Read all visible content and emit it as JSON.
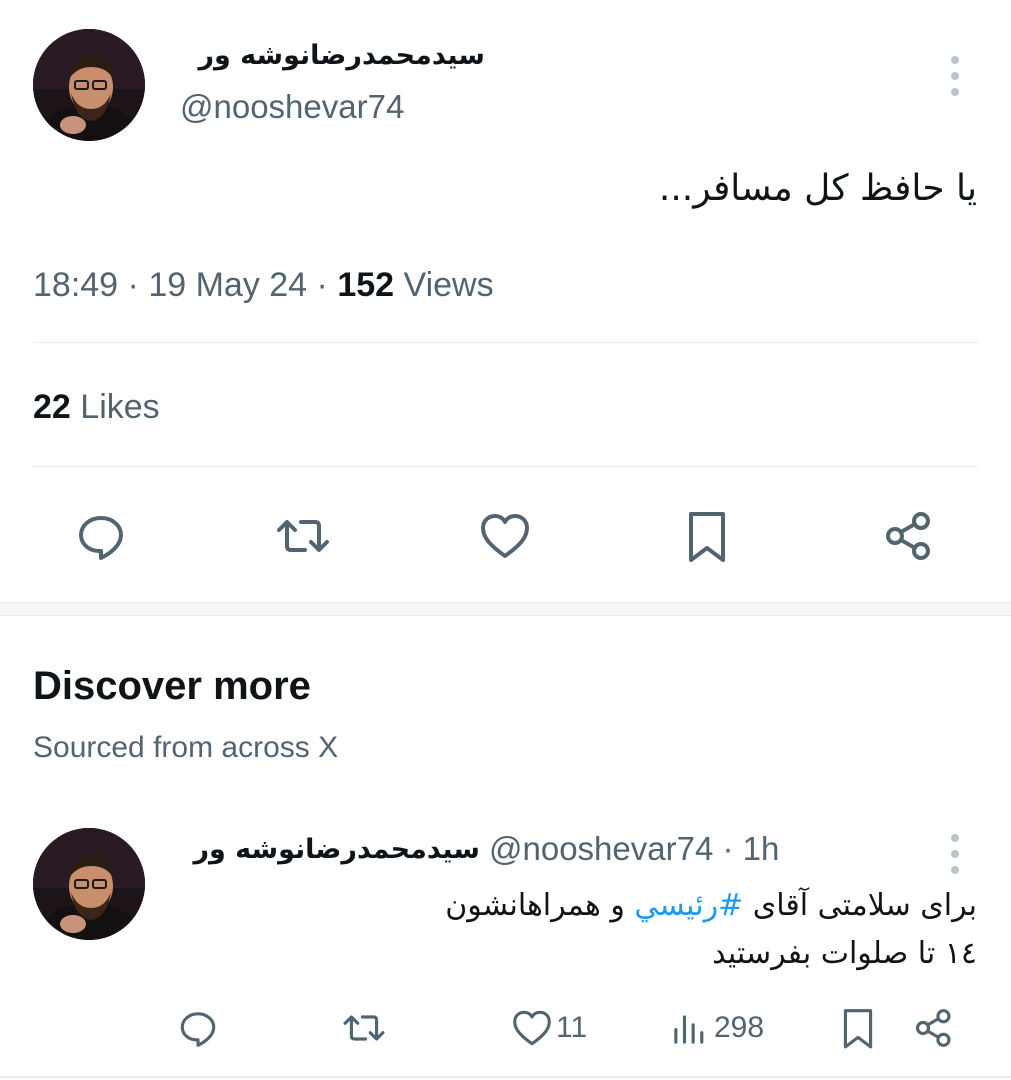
{
  "main_tweet": {
    "display_name": "سیدمحمدرضانوشه ور",
    "handle": "@nooshevar74",
    "text": "یا حافظ کل مسافر...",
    "time": "18:49",
    "date": "19 May 24",
    "views_count": "152",
    "views_label": "Views",
    "likes_count": "22",
    "likes_label": "Likes",
    "actions": [
      "reply-icon",
      "retweet-icon",
      "like-icon",
      "bookmark-icon",
      "share-icon"
    ]
  },
  "discover": {
    "title": "Discover more",
    "subtitle": "Sourced from across X"
  },
  "sub_tweet": {
    "display_name": "سیدمحمدرضانوشه ور",
    "handle": "@nooshevar74",
    "age": "1h",
    "line1_prefix": "برای سلامتی آقای ",
    "hashtag": "#رئیسي",
    "line1_suffix": " و همراهانشون",
    "line2": "١٤ تا صلوات بفرستید",
    "like_count": "11",
    "views_count": "298"
  },
  "colors": {
    "text_primary": "#0f1419",
    "text_secondary": "#536471",
    "accent": "#1d9bf0",
    "divider": "#e7ebee"
  }
}
